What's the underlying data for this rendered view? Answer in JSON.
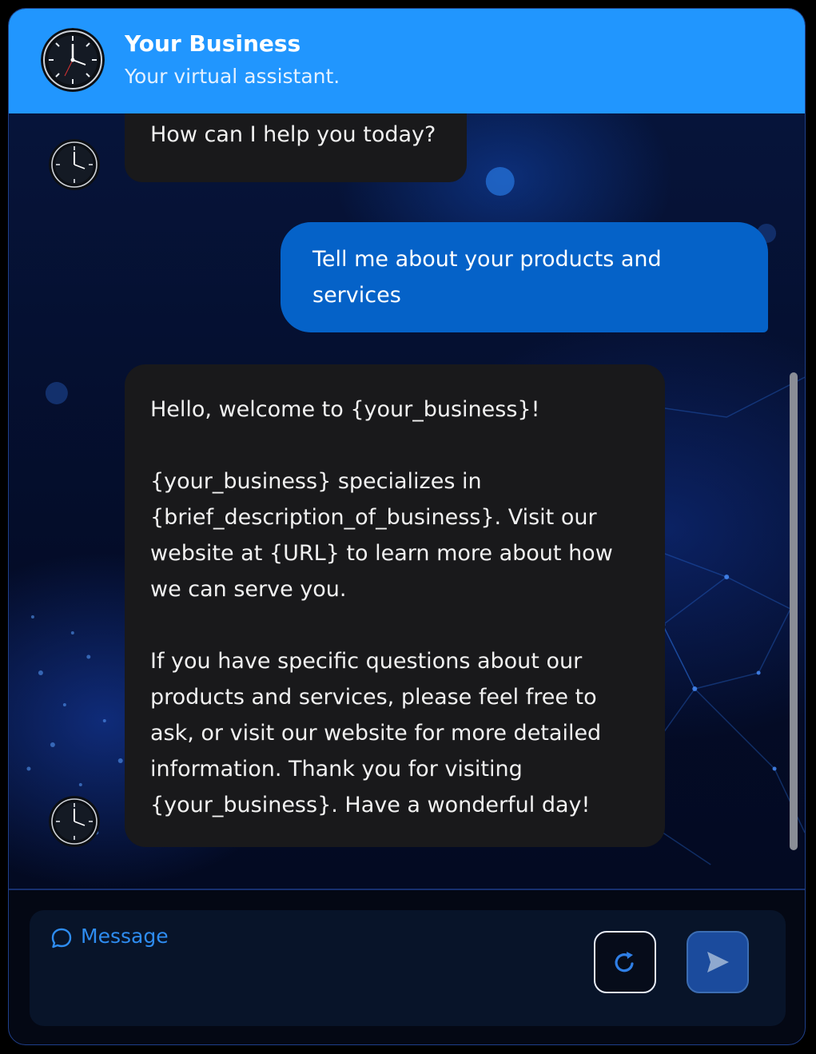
{
  "header": {
    "title": "Your Business",
    "subtitle": "Your virtual assistant.",
    "avatar_icon": "watch-face-avatar"
  },
  "messages": [
    {
      "role": "bot",
      "paragraphs": [
        "How can I help you today?"
      ]
    },
    {
      "role": "user",
      "paragraphs": [
        "Tell me about your products and services"
      ]
    },
    {
      "role": "bot",
      "paragraphs": [
        "Hello, welcome to {your_business}!",
        "{your_business} specializes in {brief_description_of_business}. Visit our website at {URL} to learn more about how we can serve you.",
        "If you have specific questions about our products and services, please feel free to ask, or visit our website for more detailed information. Thank you for visiting {your_business}. Have a wonderful day!"
      ]
    }
  ],
  "composer": {
    "placeholder": "Message",
    "placeholder_icon": "chat-bubble-icon",
    "refresh_icon": "refresh-icon",
    "send_icon": "send-icon"
  },
  "colors": {
    "header_bg": "#2196fe",
    "user_bubble": "#0562c8",
    "bot_bubble": "#19191b",
    "accent": "#2e8cf0"
  }
}
